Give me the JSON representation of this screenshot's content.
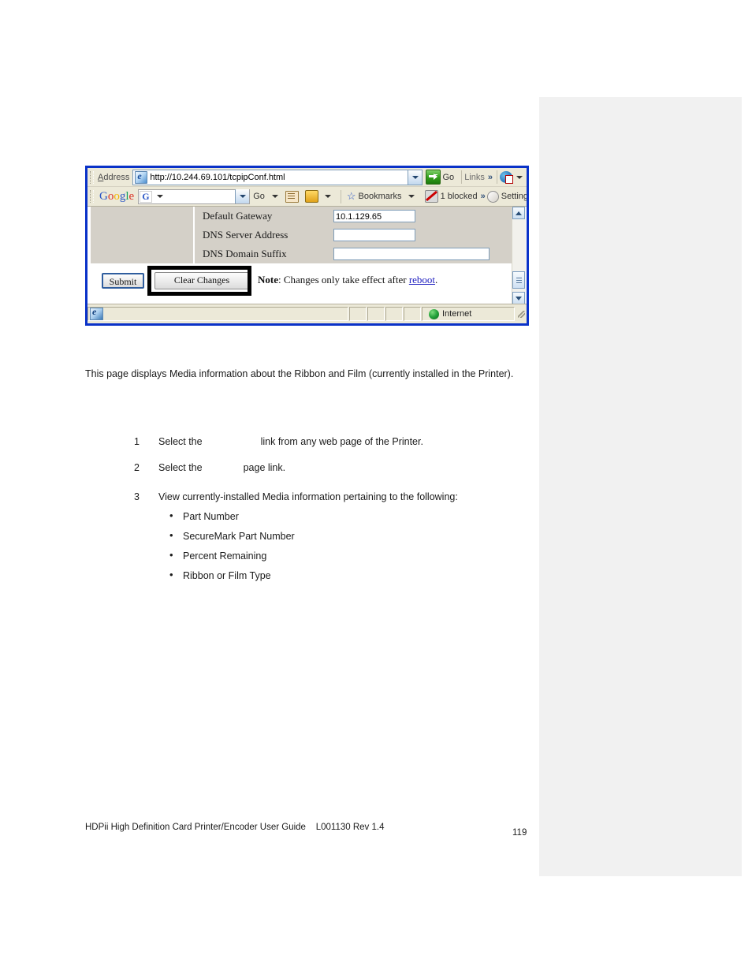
{
  "browser": {
    "address_label": "Address",
    "url": "http://10.244.69.101/tcpipConf.html",
    "go_label": "Go",
    "links_label": "Links",
    "chevrons": "»",
    "google": {
      "logo_g1": "G",
      "logo_o1": "o",
      "logo_o2": "o",
      "logo_g2": "g",
      "logo_l": "l",
      "logo_e": "e",
      "search_value": "",
      "search_badge": "G",
      "go_label": "Go",
      "bookmarks_label": "Bookmarks",
      "blocked_label": "1 blocked",
      "chevrons": "»",
      "settings_label": "Settings"
    },
    "page": {
      "fields": [
        {
          "label": "Default Gateway",
          "value": "10.1.129.65"
        },
        {
          "label": "DNS Server Address",
          "value": ""
        },
        {
          "label": "DNS Domain Suffix",
          "value": ""
        }
      ],
      "submit_label": "Submit",
      "clear_label": "Clear Changes",
      "note_prefix": "Note",
      "note_text": ": Changes only take effect after ",
      "note_link": "reboot",
      "note_suffix": "."
    },
    "status": {
      "message": "",
      "zone": "Internet"
    }
  },
  "document": {
    "intro": "This page displays Media information about the Ribbon and Film (currently installed in the Printer).",
    "steps": [
      {
        "num": "1",
        "before": "Select the",
        "after": "link from any web page of the Printer."
      },
      {
        "num": "2",
        "before": "Select the",
        "after": "page link."
      },
      {
        "num": "3",
        "text": "View currently-installed Media information pertaining to the following:"
      }
    ],
    "bullets": [
      "Part Number",
      "SecureMark Part Number",
      "Percent Remaining",
      "Ribbon or Film Type"
    ],
    "footer": "HDPii High Definition Card Printer/Encoder User Guide    L001130 Rev 1.4",
    "page_number": "119"
  },
  "colors": {
    "browser_border": "#0a32c8",
    "chrome": "#ece9d8",
    "form_bg": "#d4d0c8",
    "link": "#2020c0",
    "margin_panel": "#f1f1f1",
    "highlight_box": "#000000"
  }
}
